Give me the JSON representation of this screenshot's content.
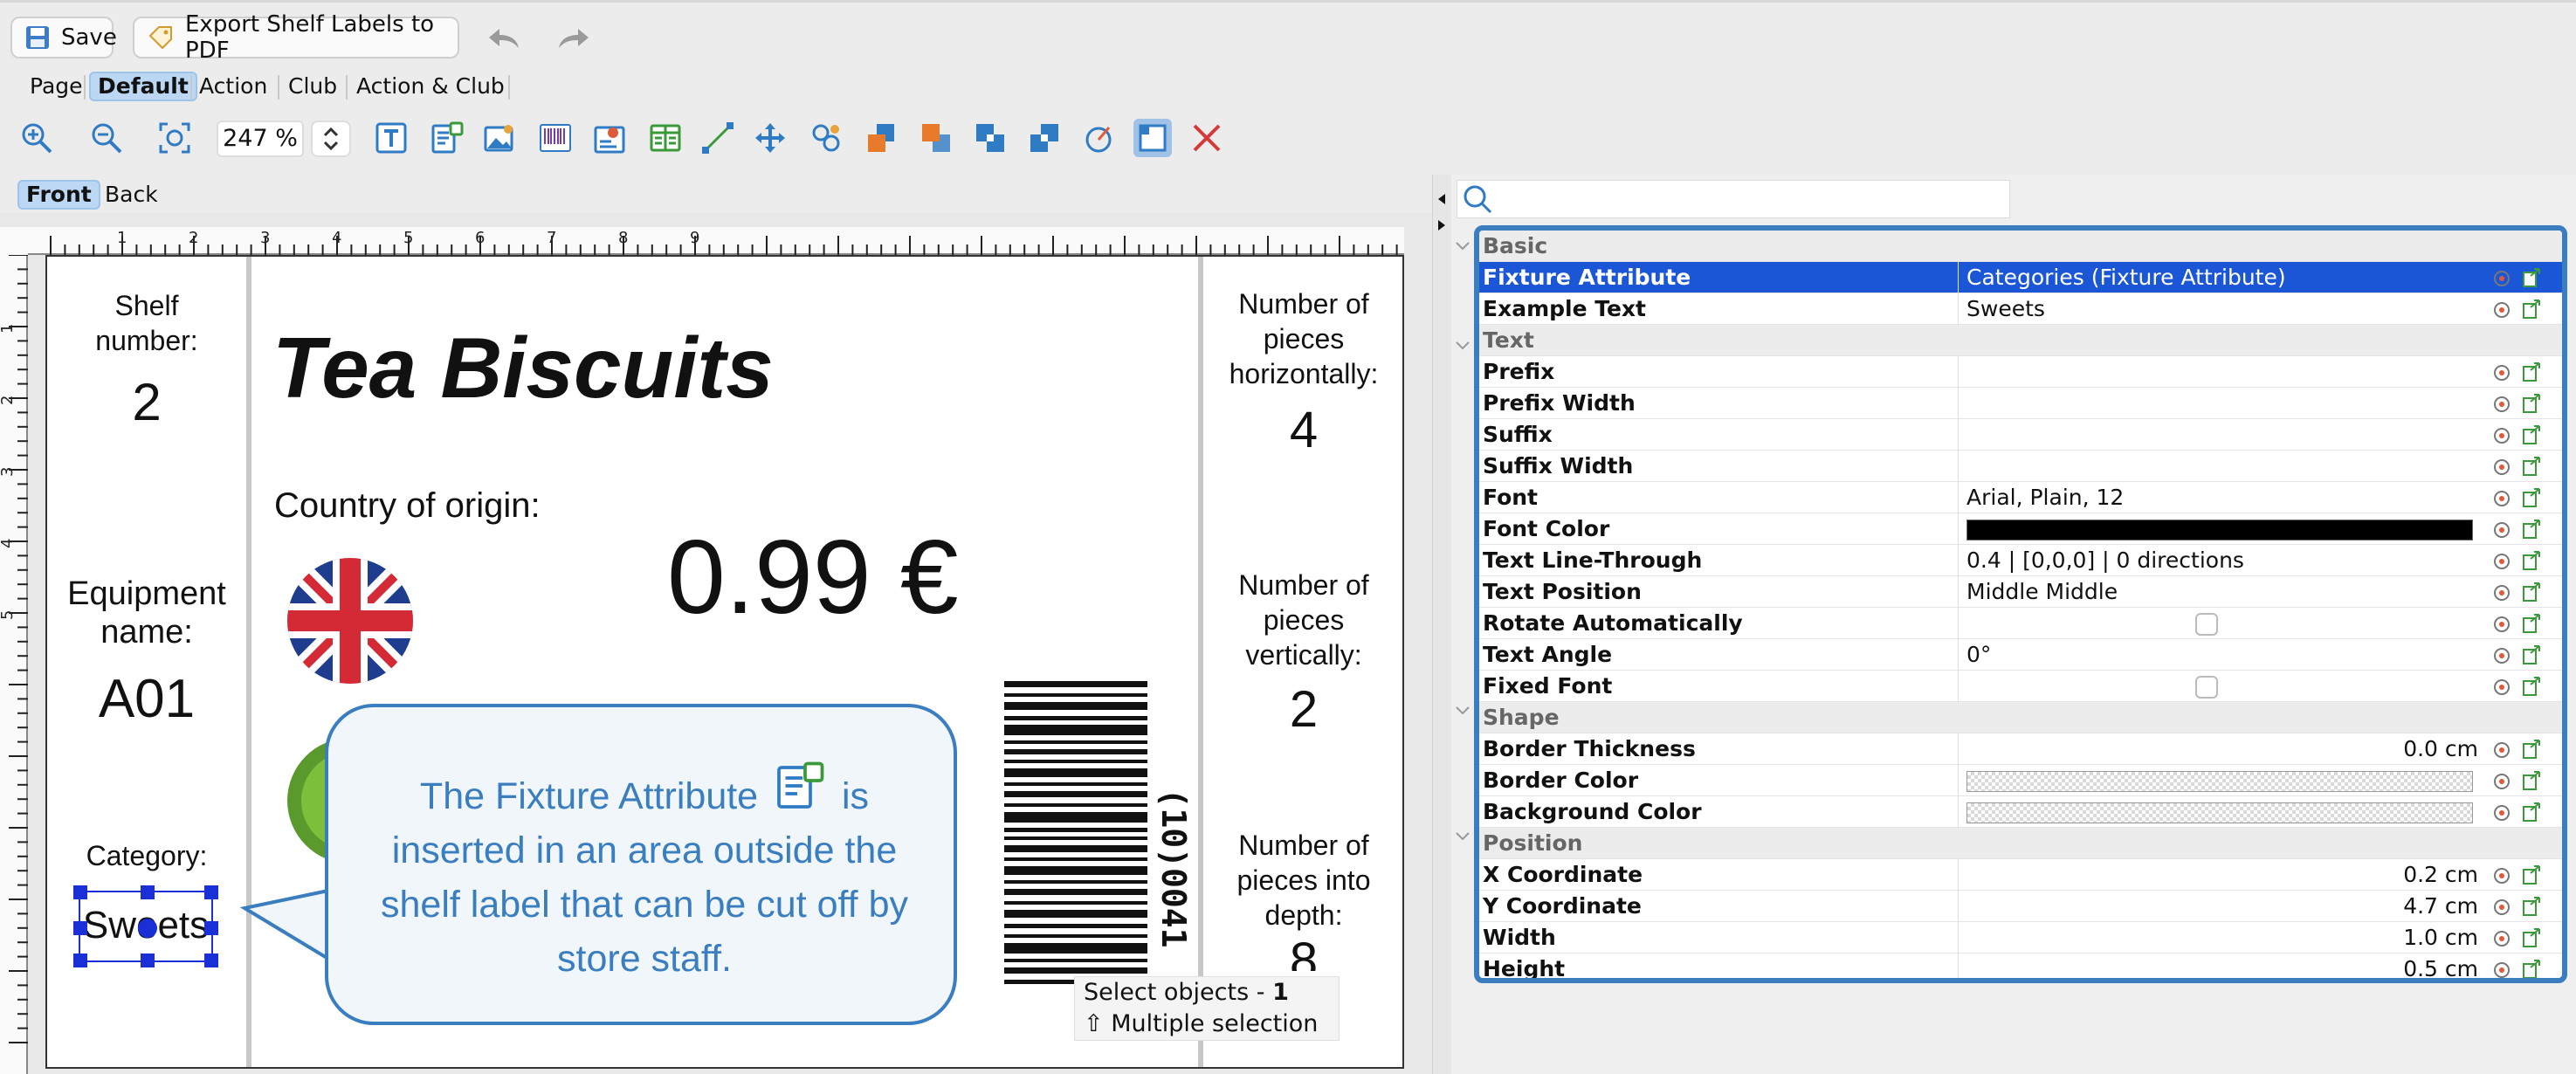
{
  "toolbar_top": {
    "save_label": "Save",
    "export_label": "Export Shelf Labels to PDF"
  },
  "page_tabs": [
    "Page",
    "Default",
    "Action",
    "Club",
    "Action & Club"
  ],
  "zoom": {
    "value": "247 %"
  },
  "side_tabs": [
    "Front",
    "Back"
  ],
  "label": {
    "shelf_number_label": "Shelf number:",
    "shelf_number_label_l1": "Shelf",
    "shelf_number_label_l2": "number:",
    "shelf_number_value": "2",
    "equipment_label_l1": "Equipment",
    "equipment_label_l2": "name:",
    "equipment_value": "A01",
    "category_label": "Category:",
    "category_value": "Sweets",
    "product_title": "Tea Biscuits",
    "country_label": "Country of origin:",
    "price": "0.99 €",
    "barcode_text": "(10)0041",
    "pieces_h_l1": "Number of",
    "pieces_h_l2": "pieces",
    "pieces_h_l3": "horizontally:",
    "pieces_h_value": "4",
    "pieces_v_l1": "Number of",
    "pieces_v_l2": "pieces",
    "pieces_v_l3": "vertically:",
    "pieces_v_value": "2",
    "pieces_d_l1": "Number of",
    "pieces_d_l2": "pieces into",
    "pieces_d_l3": "depth:",
    "pieces_d_value": "8"
  },
  "ruler": {
    "h_ticks": [
      "1",
      "2",
      "3",
      "4",
      "5",
      "6",
      "7",
      "8",
      "9"
    ],
    "v_ticks": [
      "1",
      "2",
      "3",
      "4",
      "5"
    ]
  },
  "callout": {
    "text_before": "The Fixture Attribute",
    "text_after": "is inserted in an area outside the shelf label that can be cut off by store staff."
  },
  "tooltip": {
    "line1_prefix": "Select objects - ",
    "line1_count": "1",
    "line2": "⇧ Multiple selection"
  },
  "properties": {
    "groups": {
      "basic": "Basic",
      "text": "Text",
      "shape": "Shape",
      "position": "Position"
    },
    "rows": {
      "fixture_attribute": {
        "name": "Fixture Attribute",
        "value": "Categories (Fixture Attribute)"
      },
      "example_text": {
        "name": "Example Text",
        "value": "Sweets"
      },
      "prefix": {
        "name": "Prefix",
        "value": ""
      },
      "prefix_width": {
        "name": "Prefix Width",
        "value": ""
      },
      "suffix": {
        "name": "Suffix",
        "value": ""
      },
      "suffix_width": {
        "name": "Suffix Width",
        "value": ""
      },
      "font": {
        "name": "Font",
        "value": "Arial, Plain, 12"
      },
      "font_color": {
        "name": "Font Color",
        "value": "#000000"
      },
      "text_line_through": {
        "name": "Text Line-Through",
        "value": "0.4 | [0,0,0] | 0 directions"
      },
      "text_position": {
        "name": "Text Position",
        "value": "Middle Middle"
      },
      "rotate_automatically": {
        "name": "Rotate Automatically",
        "value": false
      },
      "text_angle": {
        "name": "Text Angle",
        "value": "0°"
      },
      "fixed_font": {
        "name": "Fixed Font",
        "value": false
      },
      "border_thickness": {
        "name": "Border Thickness",
        "value": "0.0 cm"
      },
      "border_color": {
        "name": "Border Color",
        "value": "transparent"
      },
      "background_color": {
        "name": "Background Color",
        "value": "transparent"
      },
      "x_coordinate": {
        "name": "X Coordinate",
        "value": "0.2 cm"
      },
      "y_coordinate": {
        "name": "Y Coordinate",
        "value": "4.7 cm"
      },
      "width": {
        "name": "Width",
        "value": "1.0 cm"
      },
      "height": {
        "name": "Height",
        "value": "0.5 cm"
      }
    }
  },
  "colors": {
    "accent": "#3a7ebf",
    "selection": "#1a56d6",
    "selection_handle": "#1a2fd6"
  }
}
